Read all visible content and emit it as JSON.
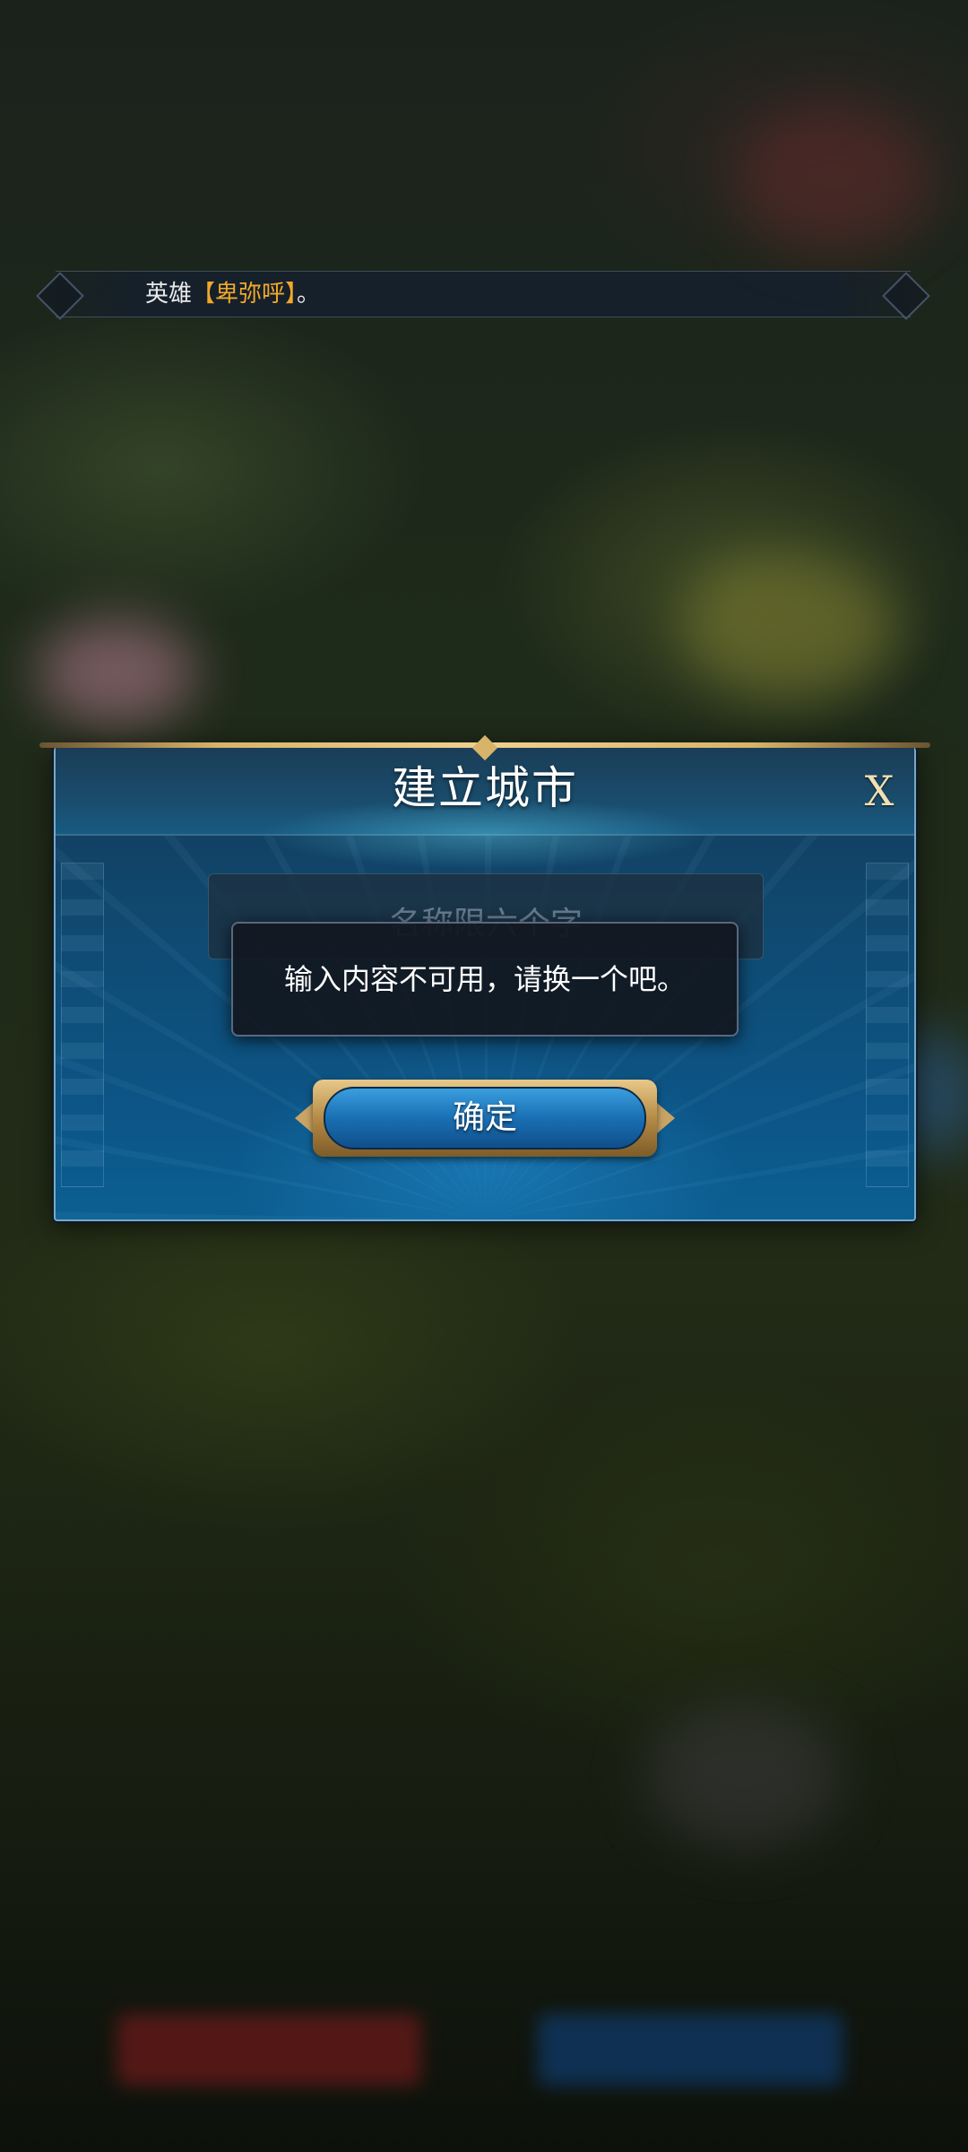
{
  "banner": {
    "prefix": "英雄",
    "hero_name": "【卑弥呼】",
    "suffix": "。"
  },
  "dialog": {
    "title": "建立城市",
    "close_label": "X",
    "name_placeholder": "名称限六个字",
    "confirm_label": "确定"
  },
  "toast": {
    "message": "输入内容不可用，请换一个吧。"
  },
  "colors": {
    "highlight": "#f1a82b",
    "dialog_blue": "#0c5688",
    "gold_frame": "#d8b36a"
  }
}
